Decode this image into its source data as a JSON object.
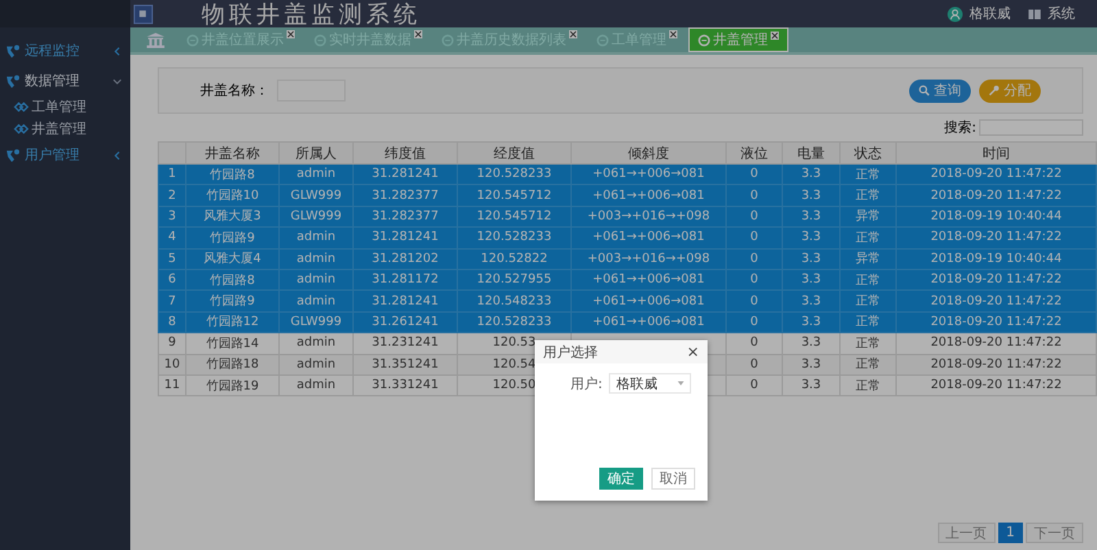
{
  "header": {
    "title": "物联井盖监测系统",
    "user": "格联威",
    "system_label": "系统"
  },
  "sidebar": {
    "items": [
      {
        "label": "远程监控",
        "expanded": false
      },
      {
        "label": "数据管理",
        "expanded": true,
        "children": [
          {
            "label": "工单管理"
          },
          {
            "label": "井盖管理"
          }
        ]
      },
      {
        "label": "用户管理",
        "expanded": false
      }
    ]
  },
  "tabs": [
    {
      "kind": "home",
      "selected": false
    },
    {
      "kind": "page",
      "label": "井盖位置展示",
      "selected": false
    },
    {
      "kind": "page",
      "label": "实时井盖数据",
      "selected": false
    },
    {
      "kind": "page",
      "label": "井盖历史数据列表",
      "selected": false
    },
    {
      "kind": "page",
      "label": "工单管理",
      "selected": false
    },
    {
      "kind": "page",
      "label": "井盖管理",
      "selected": true
    }
  ],
  "filter": {
    "label": "井盖名称：",
    "buttons": [
      {
        "kind": "search",
        "label": "查询"
      },
      {
        "kind": "assign",
        "label": "分配"
      }
    ]
  },
  "search": {
    "label": "搜索:"
  },
  "table": {
    "columns": [
      "",
      "井盖名称",
      "所属人",
      "纬度值",
      "经度值",
      "倾斜度",
      "液位",
      "电量",
      "状态",
      "时间"
    ],
    "rows": [
      {
        "selected": true,
        "cells": [
          "1",
          "竹园路8",
          "admin",
          "31.281241",
          "120.528233",
          "+061→+006→081",
          "0",
          "3.3",
          "正常",
          "2018-09-20 11:47:22"
        ]
      },
      {
        "selected": true,
        "cells": [
          "2",
          "竹园路10",
          "GLW999",
          "31.282377",
          "120.545712",
          "+061→+006→081",
          "0",
          "3.3",
          "正常",
          "2018-09-20 11:47:22"
        ]
      },
      {
        "selected": true,
        "cells": [
          "3",
          "风雅大厦3",
          "GLW999",
          "31.282377",
          "120.545712",
          "+003→+016→+098",
          "0",
          "3.3",
          "异常",
          "2018-09-19 10:40:44"
        ]
      },
      {
        "selected": true,
        "cells": [
          "4",
          "竹园路9",
          "admin",
          "31.281241",
          "120.528233",
          "+061→+006→081",
          "0",
          "3.3",
          "正常",
          "2018-09-20 11:47:22"
        ]
      },
      {
        "selected": true,
        "cells": [
          "5",
          "风雅大厦4",
          "admin",
          "31.281202",
          "120.52822",
          "+003→+016→+098",
          "0",
          "3.3",
          "异常",
          "2018-09-19 10:40:44"
        ]
      },
      {
        "selected": true,
        "cells": [
          "6",
          "竹园路8",
          "admin",
          "31.281172",
          "120.527955",
          "+061→+006→081",
          "0",
          "3.3",
          "正常",
          "2018-09-20 11:47:22"
        ]
      },
      {
        "selected": true,
        "cells": [
          "7",
          "竹园路9",
          "admin",
          "31.281241",
          "120.548233",
          "+061→+006→081",
          "0",
          "3.3",
          "正常",
          "2018-09-20 11:47:22"
        ]
      },
      {
        "selected": true,
        "cells": [
          "8",
          "竹园路12",
          "GLW999",
          "31.261241",
          "120.528233",
          "+061→+006→081",
          "0",
          "3.3",
          "正常",
          "2018-09-20 11:47:22"
        ]
      },
      {
        "selected": false,
        "cells": [
          "9",
          "竹园路14",
          "admin",
          "31.231241",
          "120.53",
          null,
          "0",
          "3.3",
          "正常",
          "2018-09-20 11:47:22"
        ]
      },
      {
        "selected": false,
        "cells": [
          "10",
          "竹园路18",
          "admin",
          "31.351241",
          "120.54",
          null,
          "0",
          "3.3",
          "正常",
          "2018-09-20 11:47:22"
        ]
      },
      {
        "selected": false,
        "cells": [
          "11",
          "竹园路19",
          "admin",
          "31.331241",
          "120.50",
          null,
          "0",
          "3.3",
          "正常",
          "2018-09-20 11:47:22"
        ]
      }
    ]
  },
  "pagination": {
    "prev": "上一页",
    "pages": [
      {
        "label": "1",
        "selected": true
      }
    ],
    "next": "下一页"
  },
  "dialog": {
    "title": "用户选择",
    "close": "×",
    "field_label": "用户:",
    "value": "格联威",
    "buttons": [
      {
        "kind": "primary",
        "label": "确定"
      },
      {
        "kind": "default",
        "label": "取消"
      }
    ]
  }
}
